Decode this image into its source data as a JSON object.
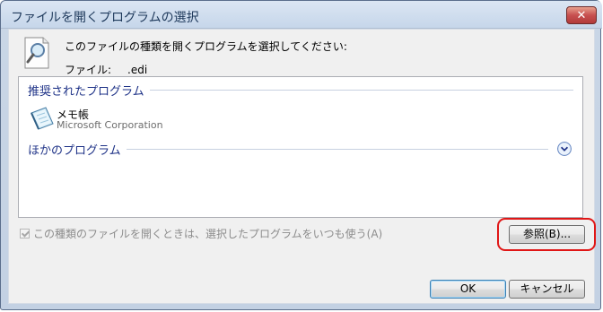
{
  "window": {
    "title": "ファイルを開くプログラムの選択",
    "close_label": "✕"
  },
  "header": {
    "prompt": "このファイルの種類を開くプログラムを選択してください:",
    "file_label": "ファイル:",
    "file_name": ".edi"
  },
  "list": {
    "recommended_heading": "推奨されたプログラム",
    "programs": [
      {
        "name": "メモ帳",
        "company": "Microsoft Corporation",
        "icon": "notepad-icon"
      }
    ],
    "other_heading": "ほかのプログラム"
  },
  "always_use": {
    "label": "この種類のファイルを開くときは、選択したプログラムをいつも使う(A)",
    "checked": true,
    "enabled": false
  },
  "buttons": {
    "browse": "参照(B)...",
    "ok": "OK",
    "cancel": "キャンセル"
  },
  "colors": {
    "heading": "#1e3287",
    "highlight": "#e01616"
  }
}
